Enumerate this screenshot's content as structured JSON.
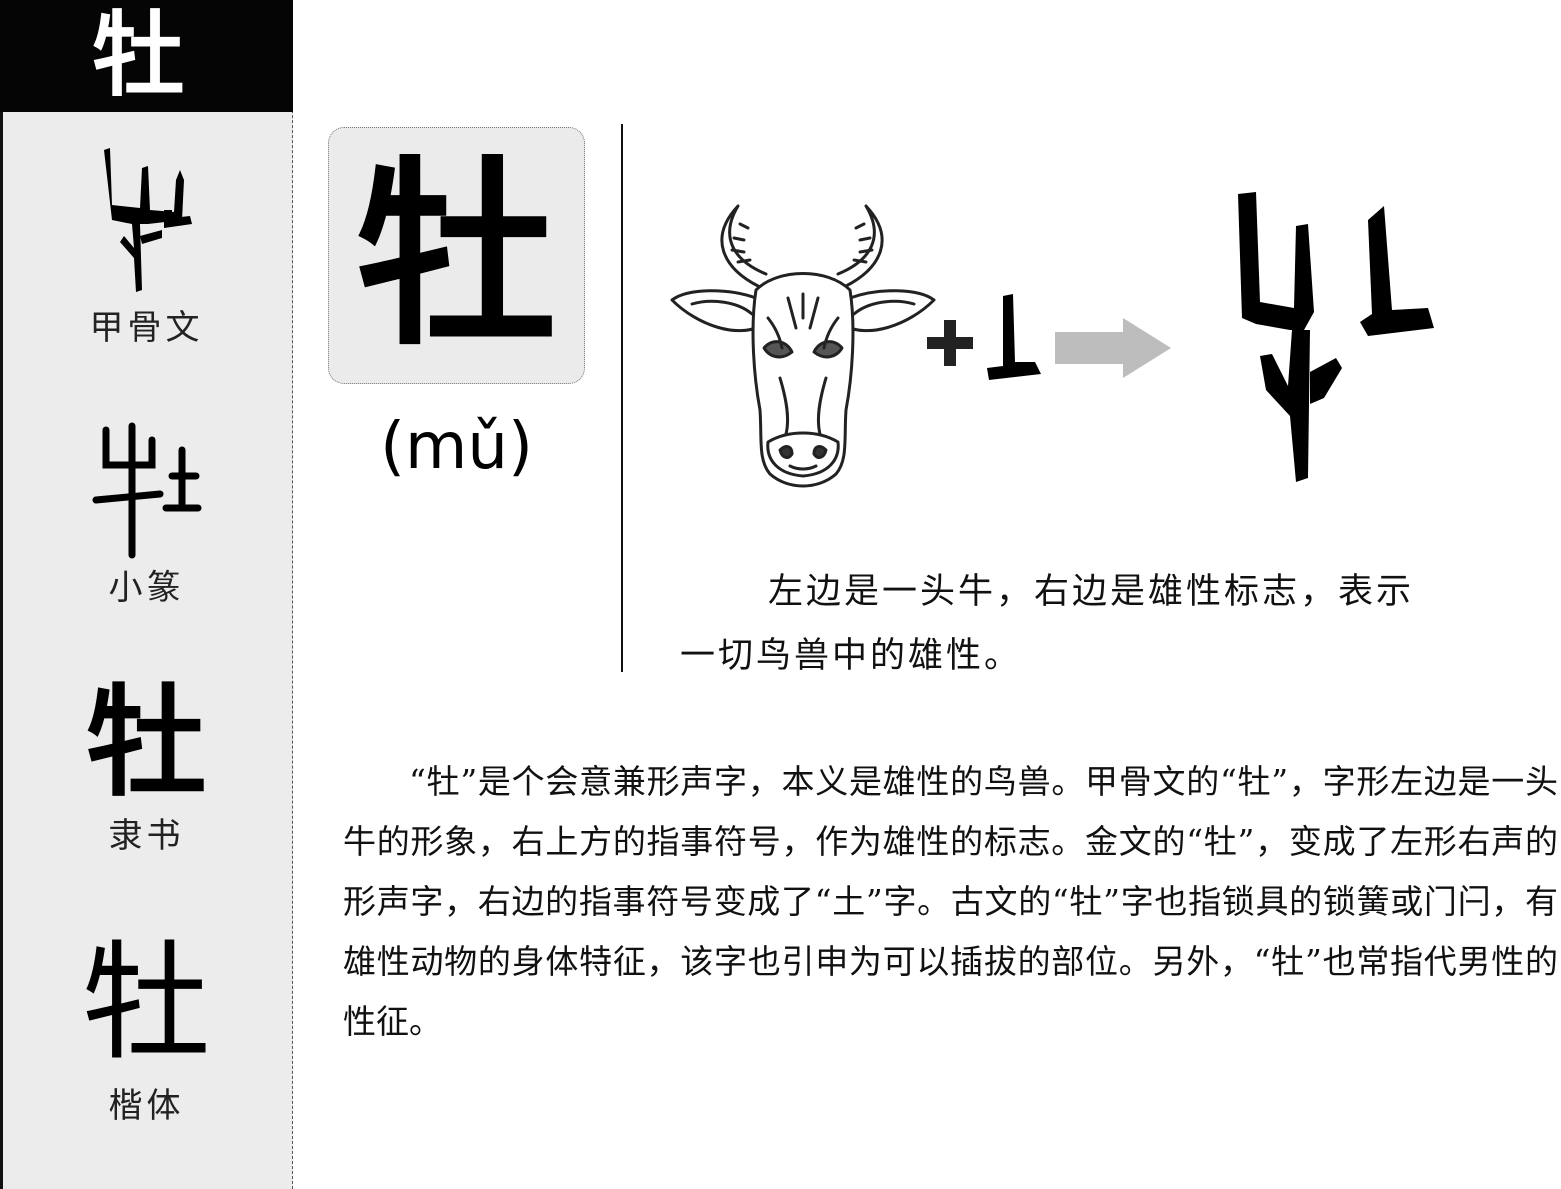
{
  "character": "牡",
  "pinyin": "(mǔ)",
  "sidebar": {
    "scripts": [
      {
        "label": "甲骨文",
        "style": "oracle-bone"
      },
      {
        "label": "小篆",
        "style": "small-seal",
        "glyph": "牡"
      },
      {
        "label": "隶书",
        "style": "clerical",
        "glyph": "牡"
      },
      {
        "label": "楷体",
        "style": "regular",
        "glyph": "牡"
      }
    ]
  },
  "illustration": {
    "left_image": "ox-head-drawing",
    "operator": "+",
    "arrow_color": "#bdbdbd"
  },
  "caption": "左边是一头牛，右边是雄性标志，表示一切鸟兽中的雄性。",
  "body": "“牡”是个会意兼形声字，本义是雄性的鸟兽。甲骨文的“牡”，字形左边是一头牛的形象，右上方的指事符号，作为雄性的标志。金文的“牡”，变成了左形右声的形声字，右边的指事符号变成了“土”字。古文的“牡”字也指锁具的锁簧或门闩，有雄性动物的身体特征，该字也引申为可以插拔的部位。另外，“牡”也常指代男性的性征。"
}
